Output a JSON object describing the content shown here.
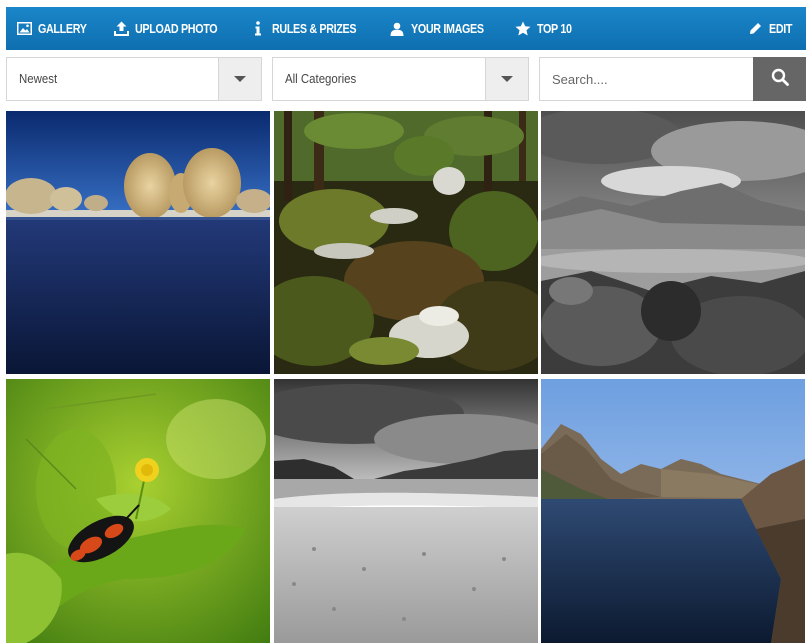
{
  "nav": {
    "items": [
      {
        "label": "Gallery",
        "icon": "image-icon"
      },
      {
        "label": "Upload Photo",
        "icon": "upload-icon"
      },
      {
        "label": "Rules & Prizes",
        "icon": "info-icon"
      },
      {
        "label": "Your Images",
        "icon": "user-icon"
      },
      {
        "label": "Top 10",
        "icon": "star-icon"
      }
    ],
    "edit_label": "Edit",
    "color": "#1478bd"
  },
  "filters": {
    "sort_value": "Newest",
    "category_value": "All Categories"
  },
  "search": {
    "placeholder": "Search....",
    "value": ""
  },
  "gallery": {
    "photos": [
      {
        "subject": "frosted willow trees by a dark blue lake"
      },
      {
        "subject": "mossy forest stream with small waterfalls"
      },
      {
        "subject": "black and white mountains above a reservoir"
      },
      {
        "subject": "red and black bug on a green leaf with a yellow flower"
      },
      {
        "subject": "black and white sandy beach under stormy clouds"
      },
      {
        "subject": "mountain lake with rocky cliffs under blue sky"
      }
    ]
  }
}
